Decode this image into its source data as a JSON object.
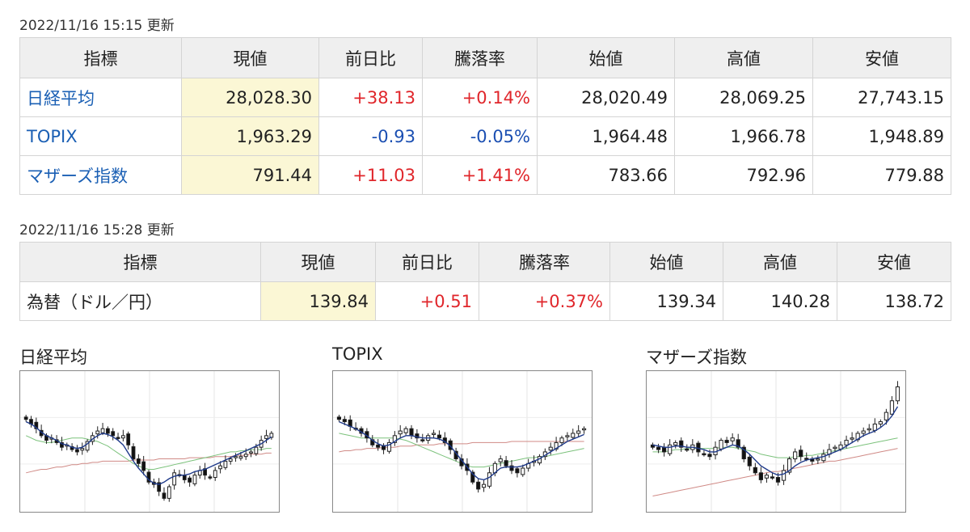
{
  "stock_section": {
    "updated": "2022/11/16 15:15 更新",
    "headers": [
      "指標",
      "現値",
      "前日比",
      "騰落率",
      "始値",
      "高値",
      "安値"
    ],
    "rows": [
      {
        "name": "日経平均",
        "current": "28,028.30",
        "change": "+38.13",
        "rate": "+0.14%",
        "open": "28,020.49",
        "high": "28,069.25",
        "low": "27,743.15",
        "dir": "up"
      },
      {
        "name": "TOPIX",
        "current": "1,963.29",
        "change": "-0.93",
        "rate": "-0.05%",
        "open": "1,964.48",
        "high": "1,966.78",
        "low": "1,948.89",
        "dir": "down"
      },
      {
        "name": "マザーズ指数",
        "current": "791.44",
        "change": "+11.03",
        "rate": "+1.41%",
        "open": "783.66",
        "high": "792.96",
        "low": "779.88",
        "dir": "up"
      }
    ]
  },
  "fx_section": {
    "updated": "2022/11/16 15:28 更新",
    "headers": [
      "指標",
      "現値",
      "前日比",
      "騰落率",
      "始値",
      "高値",
      "安値"
    ],
    "rows": [
      {
        "name": "為替（ドル／円）",
        "current": "139.84",
        "change": "+0.51",
        "rate": "+0.37%",
        "open": "139.34",
        "high": "140.28",
        "low": "138.72",
        "dir": "up"
      }
    ]
  },
  "charts": [
    {
      "title": "日経平均",
      "closes": [
        74,
        70,
        66,
        60,
        56,
        58,
        54,
        50,
        52,
        48,
        46,
        49,
        55,
        60,
        64,
        66,
        62,
        60,
        58,
        60,
        52,
        40,
        36,
        30,
        20,
        18,
        12,
        6,
        16,
        28,
        26,
        22,
        20,
        26,
        30,
        26,
        24,
        30,
        34,
        38,
        40,
        42,
        42,
        44,
        46,
        50,
        56,
        60,
        62
      ],
      "ma_short": [
        72,
        70,
        67,
        63,
        60,
        58,
        56,
        53,
        52,
        50,
        49,
        50,
        53,
        57,
        60,
        62,
        61,
        59,
        56,
        52,
        45,
        38,
        32,
        27,
        22,
        19,
        18,
        20,
        23,
        25,
        26,
        26,
        27,
        29,
        30,
        31,
        33,
        35,
        37,
        39,
        41,
        43,
        45,
        47,
        49,
        51,
        53,
        56,
        59
      ],
      "ma_long": [
        60,
        58,
        56,
        55,
        54,
        54,
        55,
        56,
        57,
        58,
        58,
        58,
        57,
        56,
        55,
        53,
        51,
        48,
        45,
        42,
        39,
        36,
        34,
        32,
        31,
        31,
        32,
        33,
        34,
        35,
        36,
        37,
        38,
        39,
        40,
        41,
        42,
        43,
        44,
        45,
        46,
        46,
        47,
        47,
        48,
        48,
        48,
        49,
        49
      ],
      "ma_base": [
        28,
        29,
        30,
        31,
        31,
        32,
        33,
        33,
        34,
        35,
        35,
        36,
        36,
        37,
        37,
        38,
        38,
        38,
        38,
        38,
        38,
        39,
        39,
        39,
        39,
        39,
        40,
        40,
        40,
        40,
        40,
        40,
        41,
        41,
        41,
        41,
        41,
        42,
        42,
        42,
        42,
        43,
        43,
        43,
        44,
        44,
        44,
        45,
        45
      ]
    },
    {
      "title": "TOPIX",
      "closes": [
        74,
        72,
        68,
        66,
        62,
        58,
        52,
        50,
        48,
        54,
        60,
        64,
        66,
        60,
        58,
        56,
        60,
        62,
        58,
        54,
        48,
        40,
        34,
        30,
        20,
        14,
        18,
        28,
        36,
        40,
        34,
        30,
        28,
        32,
        36,
        38,
        42,
        46,
        50,
        54,
        58,
        60,
        62,
        64,
        66
      ],
      "ma_short": [
        72,
        70,
        68,
        66,
        63,
        60,
        56,
        53,
        51,
        52,
        55,
        58,
        60,
        60,
        59,
        58,
        58,
        58,
        57,
        55,
        51,
        45,
        39,
        33,
        27,
        23,
        22,
        24,
        28,
        32,
        33,
        33,
        33,
        34,
        36,
        38,
        40,
        43,
        46,
        49,
        52,
        55,
        57,
        59,
        61
      ],
      "ma_long": [
        62,
        61,
        60,
        59,
        58,
        58,
        58,
        58,
        58,
        58,
        58,
        57,
        56,
        54,
        52,
        50,
        48,
        46,
        44,
        42,
        40,
        38,
        36,
        34,
        33,
        33,
        33,
        34,
        35,
        36,
        37,
        38,
        39,
        40,
        41,
        41,
        42,
        42,
        43,
        44,
        45,
        46,
        47,
        48,
        49
      ],
      "ma_base": [
        46,
        47,
        47,
        48,
        48,
        49,
        49,
        49,
        50,
        50,
        50,
        51,
        51,
        51,
        52,
        52,
        52,
        52,
        53,
        53,
        53,
        53,
        53,
        53,
        54,
        54,
        54,
        54,
        54,
        54,
        54,
        55,
        55,
        55,
        55,
        55,
        55,
        55,
        55,
        55,
        55,
        55,
        55,
        55,
        55
      ]
    },
    {
      "title": "マザーズ指数",
      "closes": [
        50,
        48,
        46,
        52,
        54,
        50,
        48,
        52,
        46,
        44,
        42,
        50,
        56,
        54,
        58,
        50,
        40,
        34,
        28,
        22,
        26,
        24,
        20,
        30,
        40,
        46,
        42,
        40,
        38,
        40,
        44,
        48,
        50,
        52,
        56,
        58,
        62,
        64,
        66,
        70,
        72,
        80,
        90,
        102
      ],
      "ma_short": [
        52,
        51,
        50,
        50,
        51,
        51,
        50,
        50,
        49,
        48,
        46,
        46,
        48,
        50,
        52,
        51,
        48,
        44,
        39,
        34,
        31,
        28,
        26,
        27,
        30,
        34,
        37,
        39,
        40,
        41,
        42,
        44,
        46,
        48,
        51,
        54,
        57,
        60,
        62,
        64,
        67,
        71,
        77,
        85
      ],
      "ma_long": [
        46,
        46,
        46,
        47,
        48,
        48,
        49,
        49,
        49,
        49,
        49,
        49,
        50,
        50,
        50,
        49,
        48,
        47,
        46,
        44,
        43,
        42,
        41,
        41,
        41,
        42,
        42,
        43,
        43,
        44,
        45,
        46,
        47,
        48,
        49,
        50,
        51,
        52,
        53,
        54,
        55,
        56,
        57,
        58
      ],
      "ma_base": [
        8,
        9,
        10,
        11,
        12,
        13,
        14,
        15,
        16,
        17,
        18,
        19,
        20,
        21,
        22,
        23,
        24,
        25,
        26,
        27,
        28,
        29,
        29,
        30,
        31,
        32,
        33,
        34,
        35,
        36,
        37,
        38,
        38,
        39,
        40,
        41,
        42,
        43,
        44,
        45,
        46,
        47,
        48,
        49
      ]
    }
  ],
  "colors": {
    "up": "#e0262b",
    "down": "#1b4fb2",
    "link": "#1a5fb4",
    "current_bg": "#fbf7d5",
    "ma_short": "#1f3a8a",
    "ma_mid": "#7cc27c",
    "ma_long": "#d08a86"
  }
}
